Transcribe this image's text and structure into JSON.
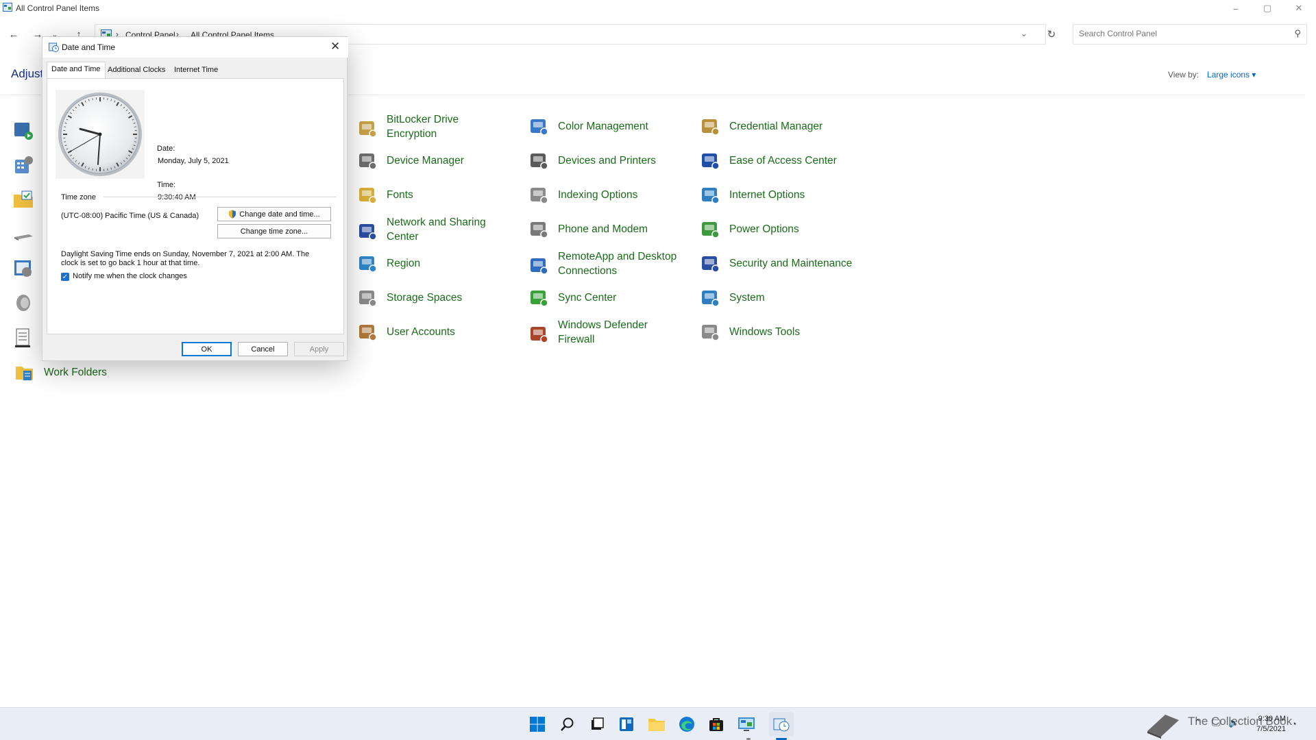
{
  "window": {
    "title": "All Control Panel Items",
    "controls": {
      "minimize": "–",
      "maximize": "▢",
      "close": "✕"
    }
  },
  "navigation": {
    "back": "←",
    "forward": "→",
    "recent": "⌄",
    "up": "↑",
    "breadcrumb": [
      "Control Panel",
      "All Control Panel Items"
    ],
    "breadcrumb_sep": "›",
    "address_dropdown": "⌄",
    "refresh": "↻",
    "search_placeholder": "Search Control Panel"
  },
  "main": {
    "heading": "Adjust",
    "view_by_label": "View by:",
    "view_by_value": "Large icons ▾",
    "items": [
      {
        "label": "BitLocker Drive Encryption",
        "icon": "bitlocker-icon",
        "color": "#c8a24a"
      },
      {
        "label": "Color Management",
        "icon": "color-management-icon",
        "color": "#3a78c8"
      },
      {
        "label": "Credential Manager",
        "icon": "credential-manager-icon",
        "color": "#b8913a"
      },
      {
        "label": "Device Manager",
        "icon": "device-manager-icon",
        "color": "#6e6e6e"
      },
      {
        "label": "Devices and Printers",
        "icon": "printer-icon",
        "color": "#5a5a5a"
      },
      {
        "label": "Ease of Access Center",
        "icon": "ease-of-access-icon",
        "color": "#1f4fa8"
      },
      {
        "label": "Fonts",
        "icon": "fonts-icon",
        "color": "#d9b03a"
      },
      {
        "label": "Indexing Options",
        "icon": "indexing-icon",
        "color": "#8a8a8a"
      },
      {
        "label": "Internet Options",
        "icon": "internet-options-icon",
        "color": "#2f7fc0"
      },
      {
        "label": "Network and Sharing Center",
        "icon": "network-icon",
        "color": "#2a4fa0"
      },
      {
        "label": "Phone and Modem",
        "icon": "phone-modem-icon",
        "color": "#7a7a7a"
      },
      {
        "label": "Power Options",
        "icon": "power-options-icon",
        "color": "#3e9a3e"
      },
      {
        "label": "Region",
        "icon": "region-icon",
        "color": "#2f86c8"
      },
      {
        "label": "RemoteApp and Desktop Connections",
        "icon": "remoteapp-icon",
        "color": "#2f6cc0"
      },
      {
        "label": "Security and Maintenance",
        "icon": "security-flag-icon",
        "color": "#2a4fa0"
      },
      {
        "label": "Storage Spaces",
        "icon": "storage-spaces-icon",
        "color": "#8a8a8a"
      },
      {
        "label": "Sync Center",
        "icon": "sync-center-icon",
        "color": "#3aa03a"
      },
      {
        "label": "System",
        "icon": "system-icon",
        "color": "#2f7fc0"
      },
      {
        "label": "User Accounts",
        "icon": "user-accounts-icon",
        "color": "#b07a3a"
      },
      {
        "label": "Windows Defender Firewall",
        "icon": "firewall-icon",
        "color": "#a8452a"
      },
      {
        "label": "Windows Tools",
        "icon": "windows-tools-icon",
        "color": "#8a8a8a"
      }
    ],
    "work_folders": "Work Folders"
  },
  "dialog": {
    "title": "Date and Time",
    "close": "✕",
    "tabs": [
      "Date and Time",
      "Additional Clocks",
      "Internet Time"
    ],
    "active_tab": "Date and Time",
    "date_label": "Date:",
    "date_value": "Monday, July 5, 2021",
    "time_label": "Time:",
    "time_value": "9:30:40 AM",
    "change_datetime_btn": "Change date and time...",
    "timezone_heading": "Time zone",
    "timezone_value": "(UTC-08:00) Pacific Time (US & Canada)",
    "change_timezone_btn": "Change time zone...",
    "dst_line1": "Daylight Saving Time ends on Sunday, November 7, 2021 at 2:00 AM. The",
    "dst_line2": "clock is set to go back 1 hour at that time.",
    "notify_label": "Notify me when the clock changes",
    "notify_checked": true,
    "ok": "OK",
    "cancel": "Cancel",
    "apply": "Apply"
  },
  "taskbar": {
    "time": "9:30 AM",
    "date": "7/5/2021",
    "watermark": "The Collection Book",
    "accent": "#0067c0"
  }
}
